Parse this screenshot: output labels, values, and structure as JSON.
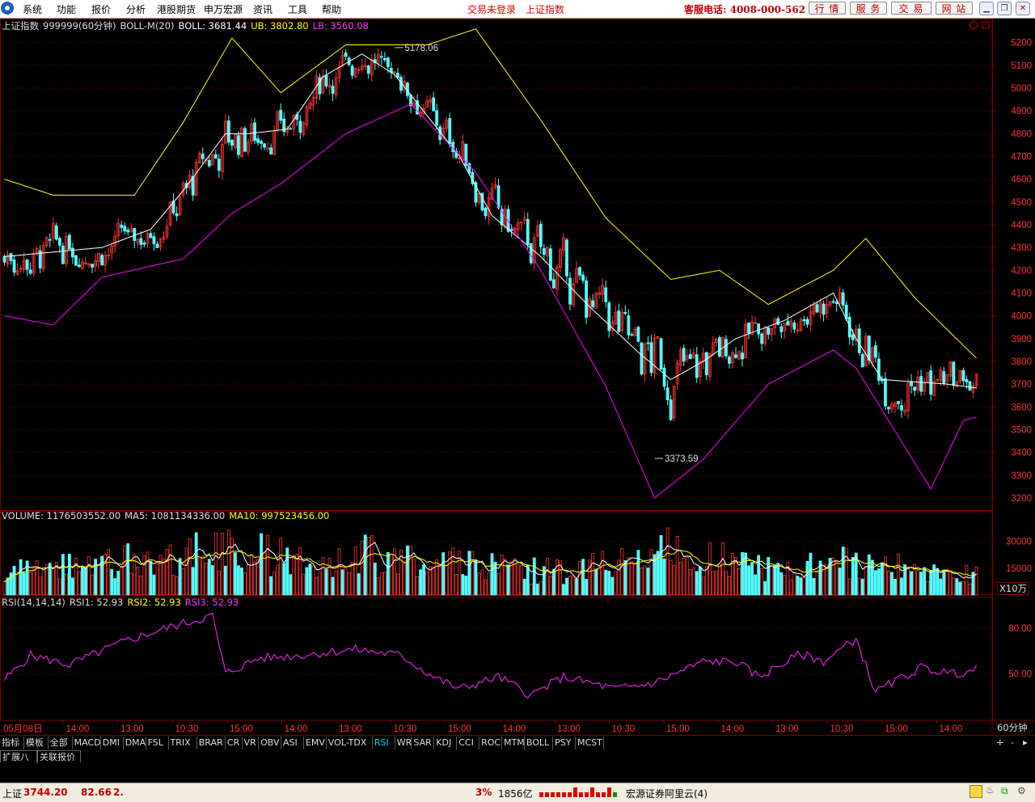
{
  "menubar": {
    "items": [
      "系统",
      "功能",
      "报价",
      "分析",
      "港股期货",
      "申万宏源",
      "资讯",
      "工具",
      "帮助"
    ],
    "status_login": "交易未登录",
    "status_index": "上证指数",
    "service_phone": "客服电话: 4008-000-562",
    "buttons": [
      "行 情",
      "服 务",
      "交 易",
      "网 站"
    ]
  },
  "price_panel": {
    "name": "上证指数",
    "code": "999999(60分钟)",
    "indicator": "BOLL-M(20)",
    "boll_label": "BOLL: 3681.44",
    "ub_label": "UB: 3802.80",
    "lb_label": "LB: 3560.08",
    "high_label": "5178.06",
    "low_label": "3373.59",
    "y_ticks": [
      "5200",
      "5100",
      "5000",
      "4900",
      "4800",
      "4700",
      "4600",
      "4500",
      "4400",
      "4300",
      "4200",
      "4100",
      "4000",
      "3900",
      "3800",
      "3700",
      "3600",
      "3500",
      "3400",
      "3300",
      "3200"
    ]
  },
  "volume_panel": {
    "volume_label": "VOLUME: 1176503552.00",
    "ma5_label": "MA5: 1081134336.00",
    "ma10_label": "MA10: 997523456.00",
    "y_ticks": [
      "30000",
      "15000"
    ],
    "unit": "X10万"
  },
  "rsi_panel": {
    "title": "RSI(14,14,14)",
    "rsi1_label": "RSI1: 52.93",
    "rsi2_label": "RSI2: 52.93",
    "rsi3_label": "RSI3: 52.93",
    "y_ticks": [
      "80.00",
      "50.00"
    ]
  },
  "time_axis": {
    "labels": [
      "05月08日",
      "14:00",
      "13:00",
      "10:30",
      "15:00",
      "14:00",
      "13:00",
      "10:30",
      "15:00",
      "14:00",
      "13:00",
      "10:30",
      "15:00",
      "14:00",
      "13:00",
      "10:30",
      "15:00",
      "14:00"
    ],
    "period": "60分钟"
  },
  "indicator_tabs": [
    "指标",
    "模板",
    "全部",
    "MACD",
    "DMI",
    "DMA",
    "FSL",
    "TRIX",
    "BRAR",
    "CR",
    "VR",
    "OBV",
    "ASI",
    "EMV",
    "VOL-TDX",
    "RSI",
    "WR",
    "SAR",
    "KDJ",
    "CCI",
    "ROC",
    "MTM",
    "BOLL",
    "PSY",
    "MCST"
  ],
  "active_tab": "RSI",
  "sub_tabs": [
    "扩展八",
    "关联报价"
  ],
  "zoom_buttons": [
    "+",
    "-"
  ],
  "statusbar": {
    "index_name": "上证",
    "index_value": "3744.20",
    "change": "82.66",
    "pct": "2.",
    "pct_tail": "3%",
    "turnover": "1856亿",
    "broker": "宏源证券阿里云(4)"
  },
  "colors": {
    "up": "#ff3232",
    "down": "#54ffff",
    "boll_mid": "#ffffff",
    "boll_upper": "#ffff00",
    "boll_lower": "#ff00ff",
    "grid": "#800000"
  },
  "chart_data": {
    "type": "candlestick",
    "symbol": "上证指数 999999",
    "period": "60分钟",
    "anchors": {
      "price_mid": [
        [
          0,
          4260
        ],
        [
          30,
          4300
        ],
        [
          45,
          4380
        ],
        [
          55,
          4550
        ],
        [
          68,
          4800
        ],
        [
          75,
          4800
        ],
        [
          87,
          4820
        ],
        [
          98,
          5050
        ],
        [
          110,
          5150
        ],
        [
          120,
          5060
        ],
        [
          130,
          4880
        ],
        [
          140,
          4700
        ],
        [
          150,
          4440
        ],
        [
          165,
          4260
        ],
        [
          180,
          4040
        ],
        [
          195,
          3840
        ],
        [
          205,
          3720
        ],
        [
          215,
          3800
        ],
        [
          225,
          3900
        ],
        [
          240,
          3980
        ],
        [
          255,
          4100
        ],
        [
          262,
          3900
        ],
        [
          270,
          3720
        ],
        [
          290,
          3700
        ],
        [
          300,
          3681
        ]
      ],
      "boll_upper": [
        [
          0,
          4600
        ],
        [
          15,
          4530
        ],
        [
          40,
          4530
        ],
        [
          55,
          4850
        ],
        [
          70,
          5220
        ],
        [
          85,
          4980
        ],
        [
          105,
          5190
        ],
        [
          130,
          5190
        ],
        [
          145,
          5260
        ],
        [
          165,
          4860
        ],
        [
          185,
          4430
        ],
        [
          205,
          4160
        ],
        [
          220,
          4200
        ],
        [
          235,
          4050
        ],
        [
          255,
          4200
        ],
        [
          265,
          4340
        ],
        [
          280,
          4080
        ],
        [
          300,
          3800
        ]
      ],
      "boll_lower": [
        [
          0,
          4000
        ],
        [
          15,
          3960
        ],
        [
          30,
          4170
        ],
        [
          55,
          4250
        ],
        [
          70,
          4450
        ],
        [
          85,
          4580
        ],
        [
          105,
          4800
        ],
        [
          125,
          4930
        ],
        [
          145,
          4630
        ],
        [
          165,
          4200
        ],
        [
          185,
          3690
        ],
        [
          200,
          3200
        ],
        [
          215,
          3370
        ],
        [
          235,
          3700
        ],
        [
          255,
          3850
        ],
        [
          262,
          3770
        ],
        [
          285,
          3240
        ],
        [
          295,
          3540
        ],
        [
          300,
          3560
        ]
      ],
      "volume": [
        [
          0,
          12000
        ],
        [
          30,
          18000
        ],
        [
          55,
          22000
        ],
        [
          70,
          25000
        ],
        [
          90,
          20000
        ],
        [
          110,
          22000
        ],
        [
          130,
          20000
        ],
        [
          155,
          14000
        ],
        [
          175,
          13000
        ],
        [
          205,
          26000
        ],
        [
          230,
          15000
        ],
        [
          245,
          16000
        ],
        [
          262,
          20000
        ],
        [
          285,
          11000
        ],
        [
          300,
          11765
        ]
      ],
      "rsi": [
        [
          0,
          46
        ],
        [
          8,
          62
        ],
        [
          20,
          56
        ],
        [
          38,
          72
        ],
        [
          50,
          80
        ],
        [
          64,
          88
        ],
        [
          68,
          50
        ],
        [
          78,
          60
        ],
        [
          90,
          62
        ],
        [
          108,
          66
        ],
        [
          122,
          62
        ],
        [
          132,
          48
        ],
        [
          140,
          40
        ],
        [
          152,
          48
        ],
        [
          162,
          36
        ],
        [
          172,
          48
        ],
        [
          188,
          40
        ],
        [
          200,
          44
        ],
        [
          215,
          58
        ],
        [
          225,
          58
        ],
        [
          232,
          48
        ],
        [
          245,
          63
        ],
        [
          252,
          58
        ],
        [
          262,
          73
        ],
        [
          268,
          38
        ],
        [
          282,
          54
        ],
        [
          292,
          50
        ],
        [
          300,
          53
        ]
      ],
      "high_point": [
        120,
        5178.06
      ],
      "low_point": [
        200,
        3373.59
      ]
    },
    "candle_count": 300,
    "y_range": [
      3150,
      5270
    ],
    "volume_range": [
      0,
      42000
    ],
    "rsi_range": [
      20,
      100
    ]
  }
}
